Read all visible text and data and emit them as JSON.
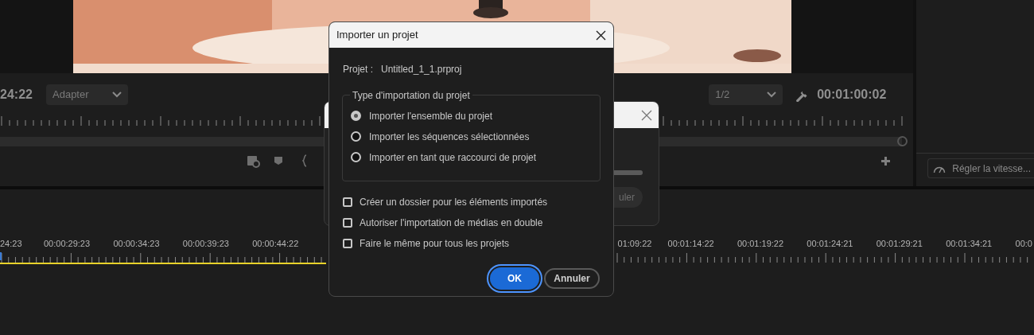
{
  "monitor": {
    "timecode_left": "24:22",
    "fit_dropdown": "Adapter",
    "resolution_dropdown": "1/2",
    "timecode": "00:01:00:02"
  },
  "speed_button": "Régler la vitesse...",
  "timeline": {
    "labels_left": [
      "24:23",
      "00:00:29:23",
      "00:00:34:23",
      "00:00:39:23",
      "00:00:44:22"
    ],
    "labels_right": [
      "01:09:22",
      "00:01:14:22",
      "00:01:19:22",
      "00:01:24:21",
      "00:01:29:21",
      "00:01:34:21",
      "00:0"
    ]
  },
  "background_dialog": {
    "button": "uler",
    "progress": {
      "level": 1
    }
  },
  "dialog": {
    "title": "Importer un projet",
    "project_label": "Projet :",
    "project_name": "Untitled_1_1.prproj",
    "group_title": "Type d'importation du projet",
    "options": [
      {
        "label": "Importer l'ensemble du projet",
        "selected": true
      },
      {
        "label": "Importer les séquences sélectionnées",
        "selected": false
      },
      {
        "label": "Importer en tant que raccourci de projet",
        "selected": false
      }
    ],
    "checkboxes": [
      {
        "label": "Créer un dossier pour les éléments importés",
        "checked": false
      },
      {
        "label": "Autoriser l'importation de médias en double",
        "checked": false
      },
      {
        "label": "Faire le même pour tous les projets",
        "checked": false
      }
    ],
    "buttons": [
      {
        "label": "OK",
        "kind": "primary"
      },
      {
        "label": "Annuler",
        "kind": "secondary"
      }
    ]
  }
}
